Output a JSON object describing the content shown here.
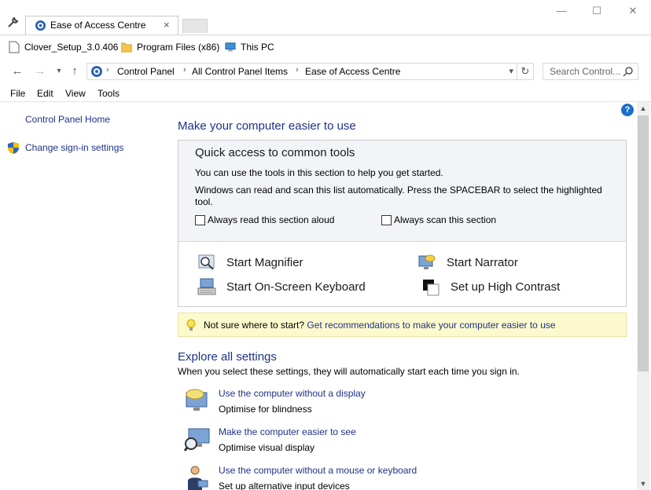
{
  "tab": {
    "title": "Ease of Access Centre",
    "close": "×"
  },
  "window": {
    "minimize": "—",
    "maximize": "☐",
    "close": "✕"
  },
  "bookmarks": [
    {
      "label": "Clover_Setup_3.0.406",
      "icon": "file-icon"
    },
    {
      "label": "Program Files (x86)",
      "icon": "folder-icon"
    },
    {
      "label": "This PC",
      "icon": "computer-icon"
    }
  ],
  "breadcrumbs": [
    "Control Panel",
    "All Control Panel Items",
    "Ease of Access Centre"
  ],
  "search": {
    "placeholder": "Search Control..."
  },
  "menu": [
    "File",
    "Edit",
    "View",
    "Tools"
  ],
  "left_pane": {
    "home": "Control Panel Home",
    "signin": "Change sign-in settings"
  },
  "main": {
    "title": "Make your computer easier to use",
    "quick_access": {
      "title": "Quick access to common tools",
      "line1": "You can use the tools in this section to help you get started.",
      "line2": "Windows can read and scan this list automatically.  Press the SPACEBAR to select the highlighted",
      "line3": "tool.",
      "read_aloud": "Always read this section aloud",
      "scan": "Always scan this section",
      "tools": {
        "magnifier": "Start Magnifier",
        "narrator": "Start Narrator",
        "keyboard": "Start On-Screen Keyboard",
        "contrast": "Set up High Contrast"
      }
    },
    "tip": {
      "text": "Not sure where to start? ",
      "link": "Get recommendations to make your computer easier to use"
    },
    "explore": {
      "title": "Explore all settings",
      "subtitle": "When you select these settings, they will automatically start each time you sign in.",
      "items": [
        {
          "link": "Use the computer without a display",
          "desc": "Optimise for blindness"
        },
        {
          "link": "Make the computer easier to see",
          "desc": "Optimise visual display"
        },
        {
          "link": "Use the computer without a mouse or keyboard",
          "desc": "Set up alternative input devices"
        }
      ]
    }
  },
  "help": "?",
  "colors": {
    "link": "#1e3287",
    "tip_bg": "#fcfacd",
    "panel_bg": "#f2f4f7"
  }
}
